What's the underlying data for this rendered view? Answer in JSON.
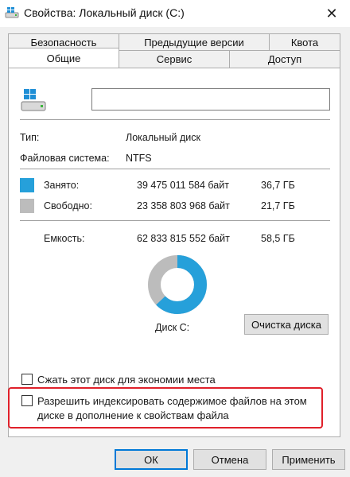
{
  "window": {
    "title": "Свойства: Локальный диск (C:)",
    "close_glyph": "✕"
  },
  "tabs": {
    "row1": [
      "Безопасность",
      "Предыдущие версии",
      "Квота"
    ],
    "row2": [
      "Общие",
      "Сервис",
      "Доступ"
    ],
    "active": "Общие"
  },
  "general": {
    "name_value": "",
    "type_label": "Тип:",
    "type_value": "Локальный диск",
    "fs_label": "Файловая система:",
    "fs_value": "NTFS",
    "used": {
      "label": "Занято:",
      "bytes": "39 475 011 584 байт",
      "size": "36,7 ГБ",
      "color": "#26a0da"
    },
    "free": {
      "label": "Свободно:",
      "bytes": "23 358 803 968 байт",
      "size": "21,7 ГБ",
      "color": "#bcbcbc"
    },
    "capacity": {
      "label": "Емкость:",
      "bytes": "62 833 815 552 байт",
      "size": "58,5 ГБ"
    },
    "used_fraction": 0.628,
    "disk_label": "Диск C:",
    "cleanup_button": "Очистка диска",
    "compress_label": "Сжать этот диск для экономии места",
    "compress_checked": false,
    "index_label_line1": "Разрешить индексировать содержимое файлов на этом",
    "index_label_line2": "диске в дополнение к свойствам файла",
    "index_checked": false
  },
  "footer": {
    "ok": "ОК",
    "cancel": "Отмена",
    "apply": "Применить"
  }
}
